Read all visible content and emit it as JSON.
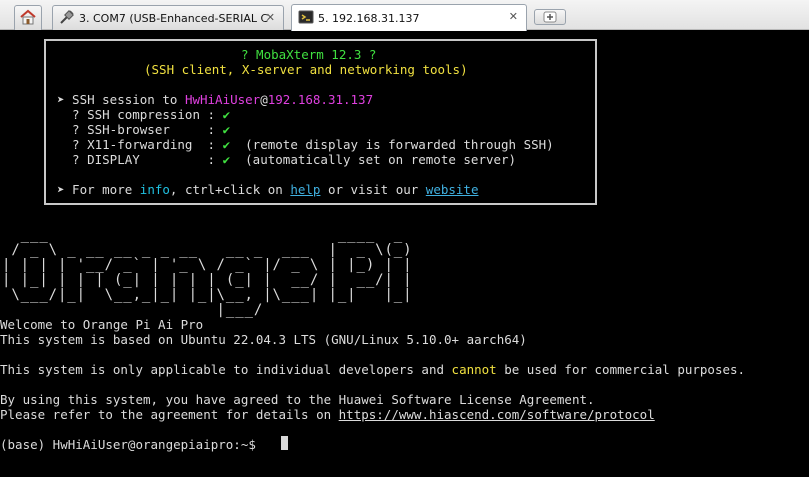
{
  "tabs": {
    "home_icon": "home-icon",
    "com7": {
      "label": "3. COM7  (USB-Enhanced-SERIAL C",
      "close": "✕"
    },
    "ssh": {
      "label": "5. 192.168.31.137",
      "close": "✕"
    },
    "add_icon": "plus-icon"
  },
  "banner": {
    "title": "? MobaXterm 12.3 ?",
    "subtitle": "(SSH client, X-server and networking tools)",
    "session_prefix": "➤ SSH session to ",
    "user": "HwHiAiUser",
    "at": "@",
    "host": "192.168.31.137",
    "rows": [
      {
        "label": "  ? SSH compression : ",
        "check": "✔",
        "note": ""
      },
      {
        "label": "  ? SSH-browser     : ",
        "check": "✔",
        "note": ""
      },
      {
        "label": "  ? X11-forwarding  : ",
        "check": "✔",
        "note": "  (remote display is forwarded through SSH)"
      },
      {
        "label": "  ? DISPLAY         : ",
        "check": "✔",
        "note": "  (automatically set on remote server)"
      }
    ],
    "more_prefix": "➤ For more ",
    "info": "info",
    "more_mid": ", ctrl+click on ",
    "help": "help",
    "more_mid2": " or visit our ",
    "website": "website"
  },
  "ascii_art": [
    "  ___                               ____  _ ",
    " / _ \\ _ __ __ _ _ __   __ _  ___  |  _ \\(_)",
    "| | | | '__/ _` | '_ \\ / _` |/ _ \\ | |_) | |",
    "| |_| | | | (_| | | | | (_| |  __/ |  __/| |",
    " \\___/|_|  \\__,_|_| |_|\\__, |\\___| |_|   |_|",
    "                       |___/                "
  ],
  "motd": {
    "welcome": "Welcome to Orange Pi Ai Pro",
    "based": "This system is based on Ubuntu 22.04.3 LTS (GNU/Linux 5.10.0+ aarch64)",
    "notice_a": "This system is only applicable to individual developers and ",
    "notice_cannot": "cannot",
    "notice_b": " be used for commercial purposes.",
    "agree1": "By using this system, you have agreed to the Huawei Software License Agreement.",
    "agree2_prefix": "Please refer to the agreement for details on ",
    "agree2_url": "https://www.hiascend.com/software/protocol"
  },
  "prompt": "(base) HwHiAiUser@orangepiaipro:~$ "
}
